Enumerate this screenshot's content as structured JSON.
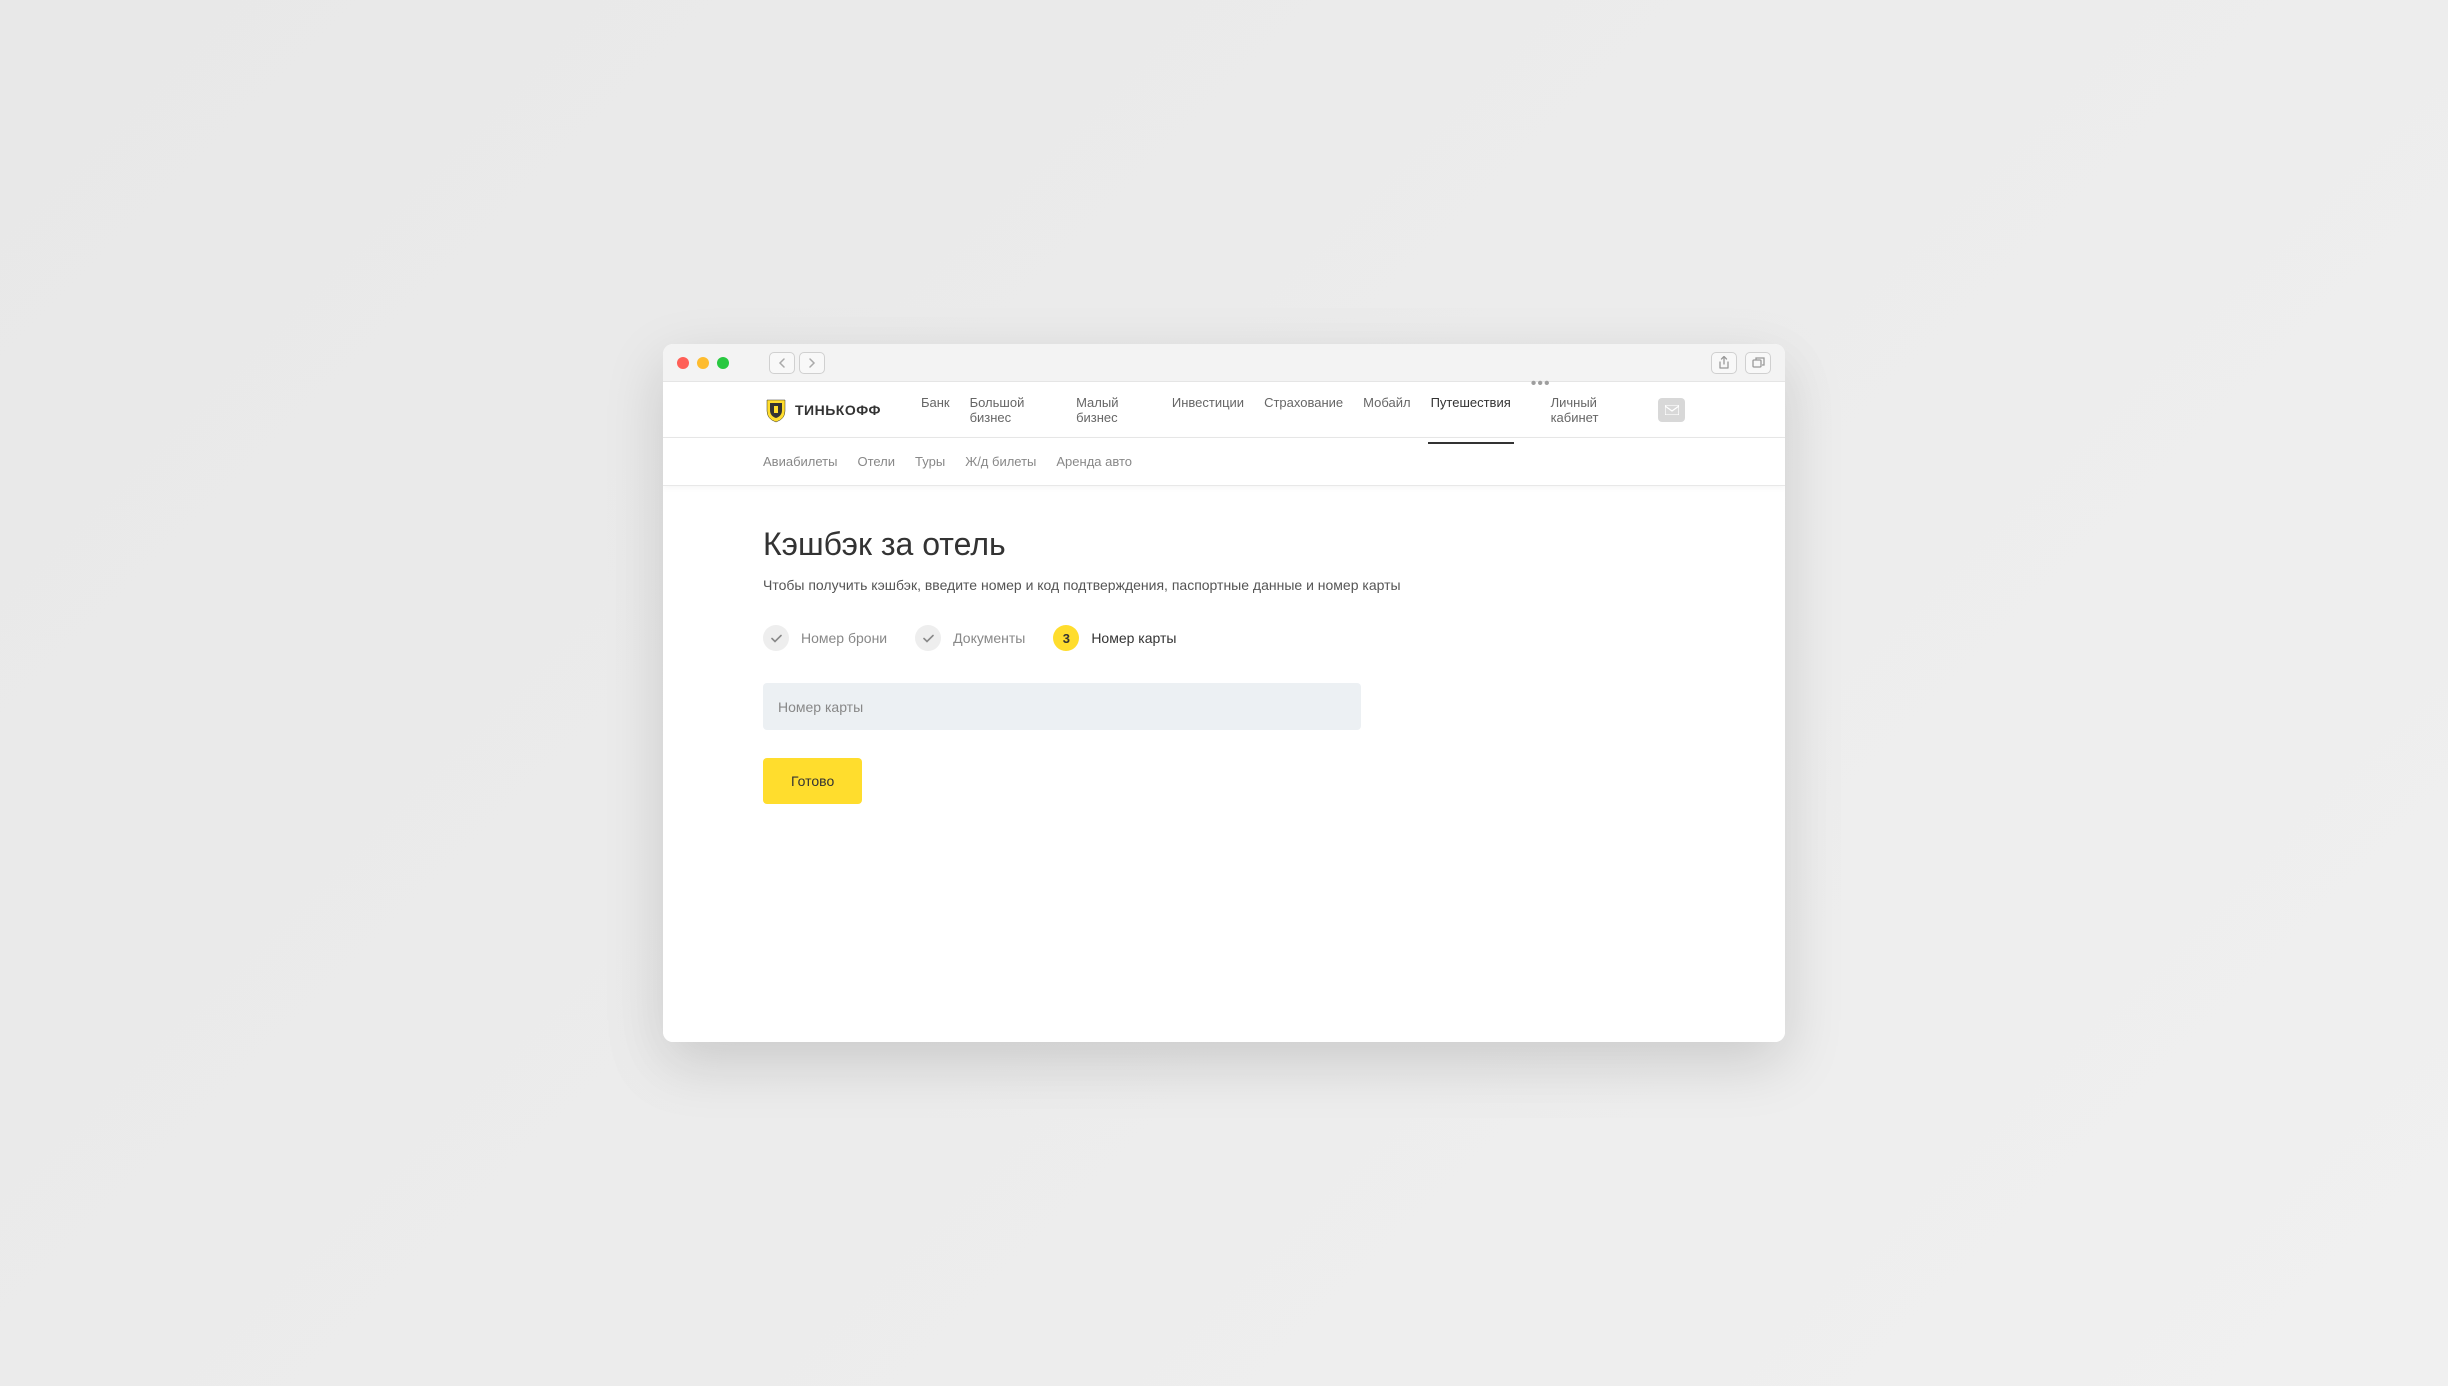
{
  "brand": "ТИНЬКОФФ",
  "main_nav": {
    "items": [
      "Банк",
      "Большой бизнес",
      "Малый бизнес",
      "Инвестиции",
      "Страхование",
      "Мобайл",
      "Путешествия"
    ],
    "active_index": 6,
    "account": "Личный кабинет"
  },
  "sub_nav": {
    "items": [
      "Авиабилеты",
      "Отели",
      "Туры",
      "Ж/д билеты",
      "Аренда авто"
    ]
  },
  "page": {
    "title": "Кэшбэк за отель",
    "description": "Чтобы получить кэшбэк, введите номер и код подтверждения, паспортные данные и номер карты"
  },
  "stepper": {
    "steps": [
      {
        "label": "Номер брони",
        "state": "done"
      },
      {
        "label": "Документы",
        "state": "done"
      },
      {
        "label": "Номер карты",
        "state": "current",
        "number": "3"
      }
    ]
  },
  "form": {
    "card_placeholder": "Номер карты",
    "submit": "Готово"
  }
}
